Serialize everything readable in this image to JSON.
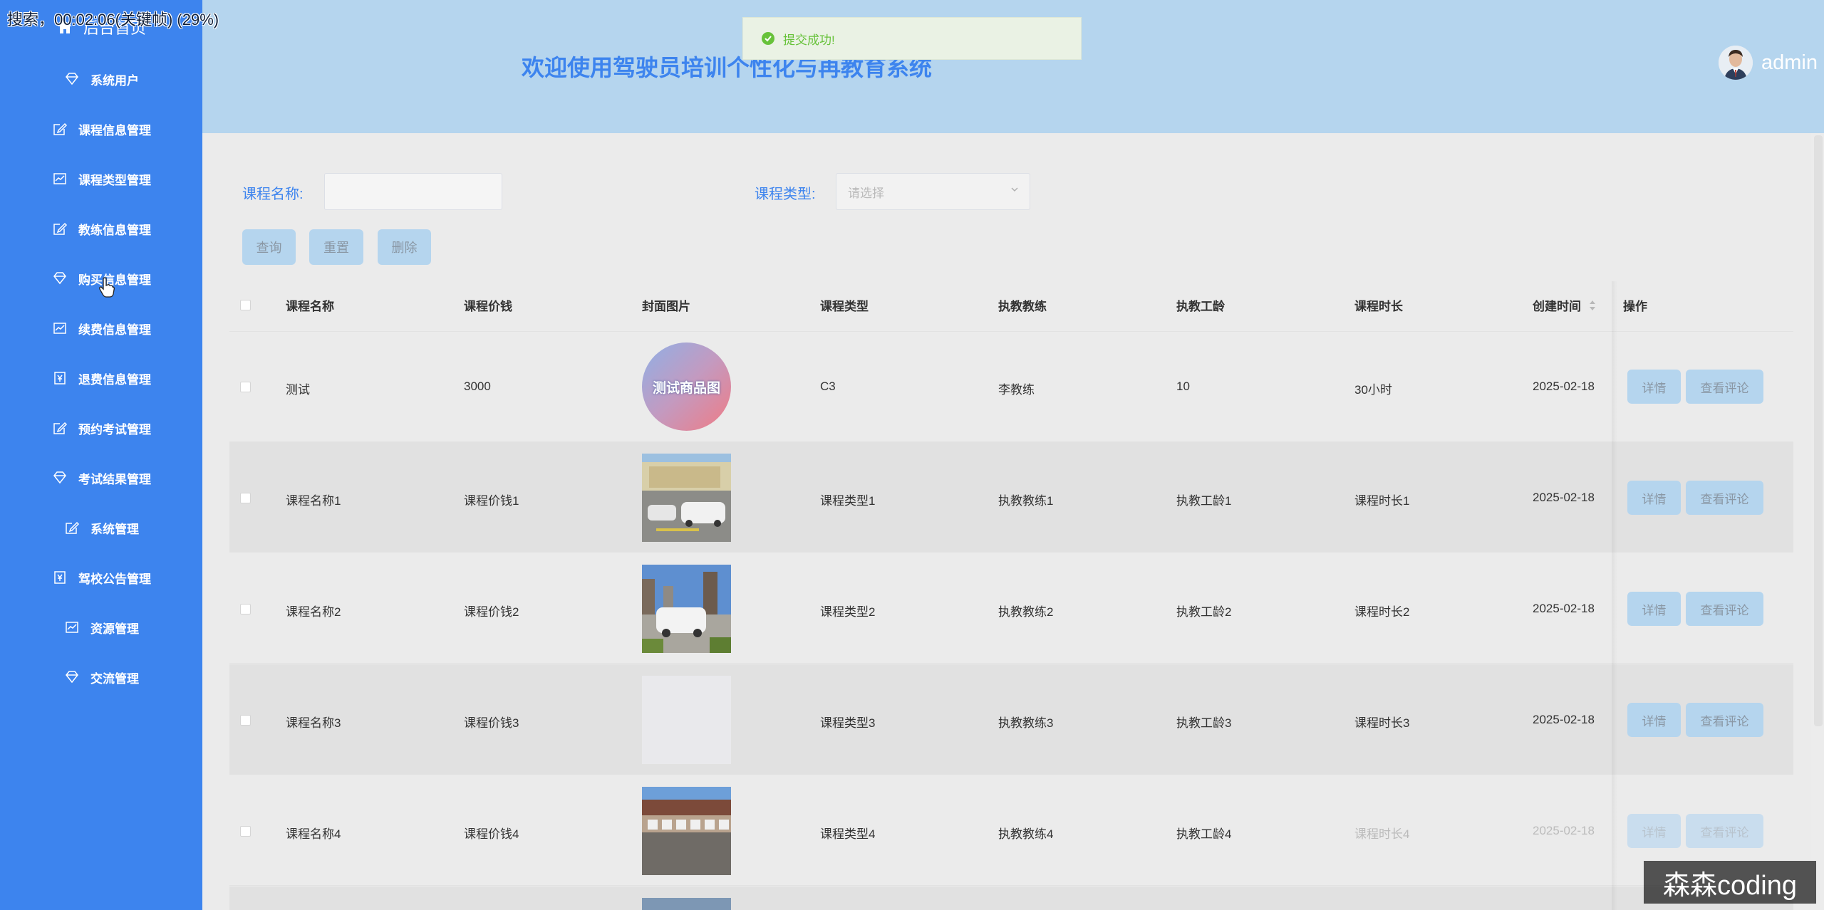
{
  "overlay": {
    "timer_text": "搜索，00:02:06(关键帧) (29%)"
  },
  "sidebar": {
    "home_label": "后台首页",
    "items": [
      {
        "label": "系统用户",
        "icon": "diamond-icon"
      },
      {
        "label": "课程信息管理",
        "icon": "edit-icon"
      },
      {
        "label": "课程类型管理",
        "icon": "chart-icon"
      },
      {
        "label": "教练信息管理",
        "icon": "edit-icon"
      },
      {
        "label": "购买信息管理",
        "icon": "diamond-icon"
      },
      {
        "label": "续费信息管理",
        "icon": "chart-icon"
      },
      {
        "label": "退费信息管理",
        "icon": "yen-icon"
      },
      {
        "label": "预约考试管理",
        "icon": "edit-icon"
      },
      {
        "label": "考试结果管理",
        "icon": "diamond-icon"
      },
      {
        "label": "系统管理",
        "icon": "edit-icon"
      },
      {
        "label": "驾校公告管理",
        "icon": "yen-icon"
      },
      {
        "label": "资源管理",
        "icon": "chart-icon"
      },
      {
        "label": "交流管理",
        "icon": "diamond-icon"
      }
    ]
  },
  "header": {
    "title": "欢迎使用驾驶员培训个性化与再教育系统",
    "username": "admin"
  },
  "toast": {
    "message": "提交成功!"
  },
  "search": {
    "name_label": "课程名称:",
    "name_value": "",
    "type_label": "课程类型:",
    "type_placeholder": "请选择",
    "query_btn": "查询",
    "reset_btn": "重置",
    "delete_btn": "删除"
  },
  "table": {
    "headers": [
      "课程名称",
      "课程价钱",
      "封面图片",
      "课程类型",
      "执教教练",
      "执教工龄",
      "课程时长",
      "创建时间",
      "操作"
    ],
    "rows": [
      {
        "name": "测试",
        "price": "3000",
        "type": "C3",
        "coach": "李教练",
        "years": "10",
        "duration": "30小时",
        "created": "2025-02-18",
        "cover": "测试商品图"
      },
      {
        "name": "课程名称1",
        "price": "课程价钱1",
        "type": "课程类型1",
        "coach": "执教教练1",
        "years": "执教工龄1",
        "duration": "课程时长1",
        "created": "2025-02-18"
      },
      {
        "name": "课程名称2",
        "price": "课程价钱2",
        "type": "课程类型2",
        "coach": "执教教练2",
        "years": "执教工龄2",
        "duration": "课程时长2",
        "created": "2025-02-18"
      },
      {
        "name": "课程名称3",
        "price": "课程价钱3",
        "type": "课程类型3",
        "coach": "执教教练3",
        "years": "执教工龄3",
        "duration": "课程时长3",
        "created": "2025-02-18"
      },
      {
        "name": "课程名称4",
        "price": "课程价钱4",
        "type": "课程类型4",
        "coach": "执教教练4",
        "years": "执教工龄4",
        "duration": "课程时长4",
        "created": "2025-02-18"
      }
    ],
    "detail_btn": "详情",
    "comment_btn": "查看评论"
  },
  "watermark": "森森coding",
  "colors": {
    "sidebar": "#3d84ee",
    "header": "#b5d5ee",
    "accent": "#3d84ee",
    "success": "#67c23a"
  }
}
